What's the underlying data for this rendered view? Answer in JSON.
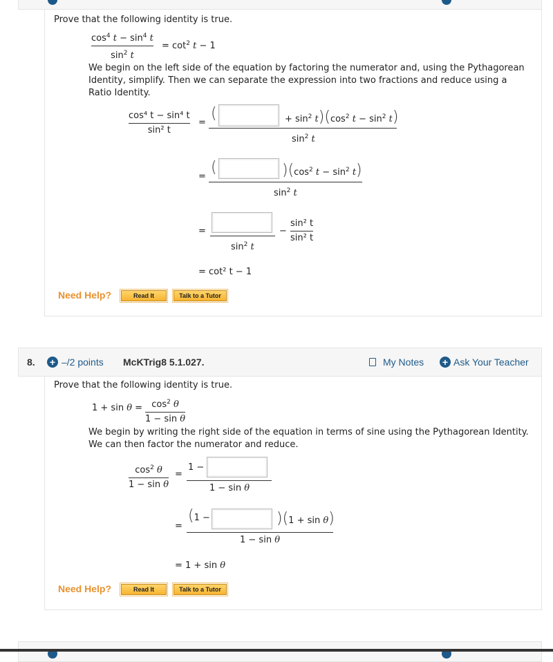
{
  "question7": {
    "prompt": "Prove that the following identity is true.",
    "identity": {
      "lhs_num": [
        "cos",
        "4",
        "t",
        " − sin",
        "4",
        "t"
      ],
      "lhs_den": [
        "sin",
        "2",
        "t"
      ],
      "rhs": [
        "= cot",
        "2",
        "t",
        " − 1"
      ]
    },
    "instructions": "We begin on the left side of the equation by factoring the numerator and, using the Pythagorean Identity, simplify. Then we can separate the expression into two fractions and reduce using a Ratio Identity.",
    "steps": {
      "s1_lhs_num": "cos⁴ t − sin⁴ t",
      "s1_lhs_den": "sin² t",
      "eq": "=",
      "s1_num_after_box": "+ sin² t",
      "s1_num_factor": "cos² t − sin² t",
      "s1_den": "sin² t",
      "s2_num_factor": "cos² t − sin² t",
      "s2_den": "sin² t",
      "s3_den": "sin² t",
      "s3_minus": "−",
      "s3_frac_num": "sin² t",
      "s3_frac_den": "sin² t",
      "s4": "= cot² t − 1"
    },
    "answers": {
      "box1": "",
      "box2": "",
      "box3": ""
    },
    "help": {
      "label": "Need Help?",
      "read_it": "Read It",
      "tutor": "Talk to a Tutor"
    }
  },
  "question8": {
    "number": "8.",
    "points": "–/2 points",
    "id": "McKTrig8 5.1.027.",
    "my_notes": "My Notes",
    "ask_teacher": "Ask Your Teacher",
    "prompt": "Prove that the following identity is true.",
    "identity": {
      "lhs": "1 + sin θ =",
      "rhs_num": "cos² θ",
      "rhs_den": "1 − sin θ"
    },
    "instructions": "We begin by writing the right side of the equation in terms of sine using the Pythagorean Identity. We can then factor the numerator and reduce.",
    "steps": {
      "s1_lhs_num": "cos² θ",
      "s1_lhs_den": "1 − sin θ",
      "eq": "=",
      "s1_num_prefix": "1 −",
      "s1_den": "1 − sin θ",
      "s2_num_prefix": "1 −",
      "s2_num_factor": "1 + sin θ",
      "s2_den": "1 − sin θ",
      "s3": "= 1 + sin θ"
    },
    "answers": {
      "box1": "",
      "box2": ""
    },
    "help": {
      "label": "Need Help?",
      "read_it": "Read It",
      "tutor": "Talk to a Tutor"
    }
  },
  "colors": {
    "accent": "#1d5a8a",
    "help": "#e8912d",
    "button": "#f7b431"
  }
}
